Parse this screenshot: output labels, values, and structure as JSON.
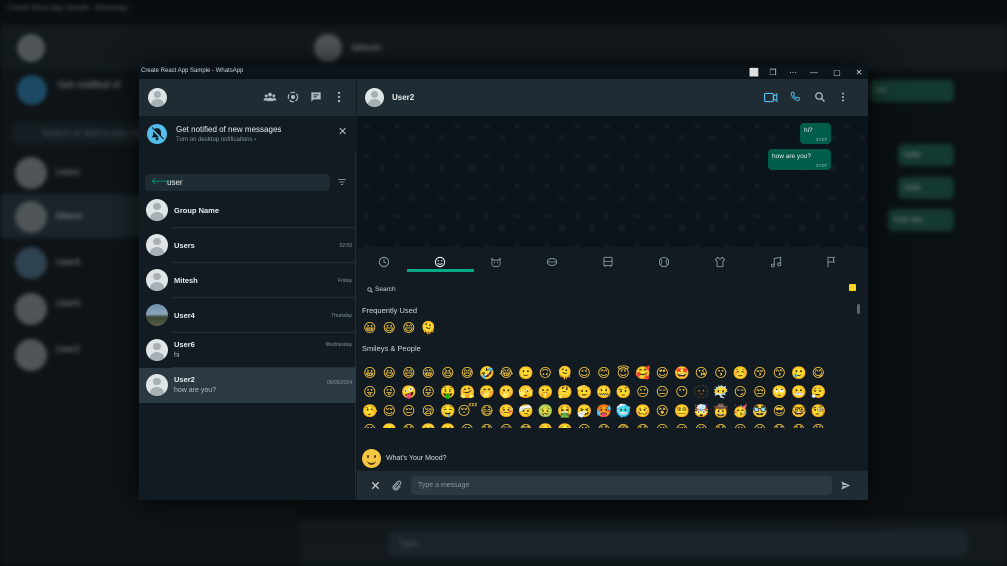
{
  "background": {
    "title": "Create React App Sample - WhatsApp",
    "contact_name": "Mitesh",
    "notification_title": "Get notified of",
    "search_placeholder": "Search or start a new chat",
    "chats": [
      "Users",
      "Mitesh",
      "User4",
      "User6",
      "User2"
    ],
    "messages": [
      "hi?",
      "hello",
      "how are"
    ],
    "compose_placeholder": "Type"
  },
  "window": {
    "title": "Create React App Sample - WhatsApp",
    "controls": [
      "⬜",
      "❒",
      "⋯",
      "—",
      "▢",
      "✕"
    ]
  },
  "sidebar": {
    "notification": {
      "title": "Get notified of new messages",
      "subtitle": "Turn on desktop notifications ›"
    },
    "search": {
      "value": "user"
    },
    "chats": [
      {
        "name": "Group Name",
        "time": "",
        "last": ""
      },
      {
        "name": "Users",
        "time": "02:00",
        "last": ""
      },
      {
        "name": "Mitesh",
        "time": "Friday",
        "last": ""
      },
      {
        "name": "User4",
        "time": "Thursday",
        "last": ""
      },
      {
        "name": "User6",
        "time": "Wednesday",
        "last": "hi"
      },
      {
        "name": "User2",
        "time": "09/05/2024",
        "last": "how are you?"
      }
    ]
  },
  "chat": {
    "contact_name": "User2",
    "messages": [
      {
        "text": "hi?",
        "time": "17:07"
      },
      {
        "text": "how are you?",
        "time": "17:07"
      }
    ]
  },
  "emoji_panel": {
    "search_label": "Search",
    "frequently_used_label": "Frequently Used",
    "smileys_label": "Smileys & People",
    "frequently_used": [
      "😀",
      "😃",
      "😄",
      "🫠"
    ],
    "rows": [
      [
        "😀",
        "😃",
        "😄",
        "😁",
        "😆",
        "😅",
        "🤣",
        "😂",
        "🙂",
        "🙃",
        "🫠",
        "😉",
        "😊",
        "😇",
        "🥰",
        "😍",
        "🤩",
        "😘",
        "😗",
        "☺️",
        "😚",
        "😙",
        "🥲",
        "😋"
      ],
      [
        "😛",
        "😜",
        "🤪",
        "😝",
        "🤑",
        "🤗",
        "🤭",
        "🫢",
        "🫣",
        "🤫",
        "🤔",
        "🫡",
        "🤐",
        "🤨",
        "😐",
        "😑",
        "😶",
        "🫥",
        "😶‍🌫️",
        "😏",
        "😒",
        "🙄",
        "😬",
        "😮‍💨"
      ],
      [
        "🤥",
        "😌",
        "😔",
        "😪",
        "🤤",
        "😴",
        "😷",
        "🤒",
        "🤕",
        "🤢",
        "🤮",
        "🤧",
        "🥵",
        "🥶",
        "🥴",
        "😵",
        "😵‍💫",
        "🤯",
        "🤠",
        "🥳",
        "🥸",
        "😎",
        "🤓",
        "🧐"
      ],
      [
        "😕",
        "🫤",
        "😟",
        "🙁",
        "☹️",
        "😮",
        "😯",
        "😲",
        "😳",
        "🥺",
        "🥹",
        "😦",
        "😧",
        "😨",
        "😰",
        "😥",
        "😢",
        "😭",
        "😱",
        "😖",
        "😣",
        "😞",
        "😓",
        "😩"
      ]
    ]
  },
  "mood": {
    "label": "What's Your Mood?"
  },
  "compose": {
    "placeholder": "Type a message"
  },
  "colors": {
    "accent": "#00a884",
    "outgoing_bubble": "#005c4b",
    "header_bg": "#202c33",
    "panel_bg": "#111b21",
    "active_chat": "#2a3942",
    "video_icon": "#53bdeb"
  },
  "icons": {
    "left_header": [
      "communities-icon",
      "status-icon",
      "new-chat-icon",
      "menu-icon"
    ],
    "right_header": [
      "video-call-icon",
      "voice-call-icon",
      "search-icon",
      "menu-icon"
    ],
    "emoji_tabs": [
      "recent-icon",
      "smileys-icon",
      "animals-icon",
      "food-icon",
      "travel-icon",
      "activity-icon",
      "objects-icon",
      "symbols-icon",
      "flags-icon"
    ]
  }
}
